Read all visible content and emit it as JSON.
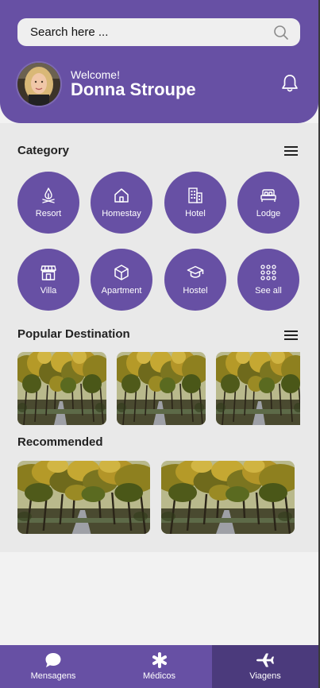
{
  "search": {
    "placeholder": "Search here ..."
  },
  "user": {
    "welcome": "Welcome!",
    "name": "Donna Stroupe"
  },
  "category": {
    "title": "Category",
    "items": [
      {
        "label": "Resort",
        "icon": "campfire-icon"
      },
      {
        "label": "Homestay",
        "icon": "home-icon"
      },
      {
        "label": "Hotel",
        "icon": "building-icon"
      },
      {
        "label": "Lodge",
        "icon": "bed-icon"
      },
      {
        "label": "Villa",
        "icon": "store-icon"
      },
      {
        "label": "Apartment",
        "icon": "cube-icon"
      },
      {
        "label": "Hostel",
        "icon": "graduation-cap-icon"
      },
      {
        "label": "See all",
        "icon": "grid-dots-icon"
      }
    ]
  },
  "popular": {
    "title": "Popular Destination"
  },
  "recommended": {
    "title": "Recommended"
  },
  "nav": [
    {
      "label": "Mensagens",
      "icon": "chat-bubble-icon",
      "active": false
    },
    {
      "label": "Médicos",
      "icon": "asterisk-icon",
      "active": false
    },
    {
      "label": "Viagens",
      "icon": "airplane-icon",
      "active": true
    }
  ],
  "colors": {
    "primary": "#6750a4",
    "active_nav": "#4b3a7c",
    "background": "#f2f2f2"
  }
}
